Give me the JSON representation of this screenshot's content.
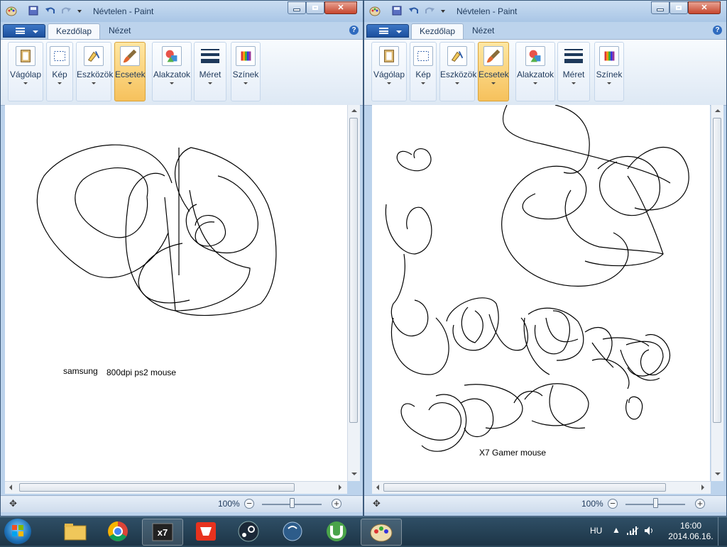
{
  "windows": [
    {
      "title": "Névtelen - Paint",
      "tabs": [
        "Kezdőlap",
        "Nézet"
      ],
      "groups": [
        {
          "label": "Vágólap",
          "icon": "clipboard-icon"
        },
        {
          "label": "Kép",
          "icon": "select-icon"
        },
        {
          "label": "Eszközök",
          "icon": "tools-icon"
        },
        {
          "label": "Ecsetek",
          "icon": "brush-icon",
          "active": true
        },
        {
          "label": "Alakzatok",
          "icon": "shapes-icon"
        },
        {
          "label": "Méret",
          "icon": "size-icon"
        },
        {
          "label": "Színek",
          "icon": "colors-icon"
        }
      ],
      "canvas_texts": [
        {
          "text": "samsung",
          "name": "caption-samsung"
        },
        {
          "text": "800dpi ps2 mouse",
          "name": "caption-800dpi"
        }
      ],
      "zoom": "100%"
    },
    {
      "title": "Névtelen - Paint",
      "tabs": [
        "Kezdőlap",
        "Nézet"
      ],
      "groups": [
        {
          "label": "Vágólap",
          "icon": "clipboard-icon"
        },
        {
          "label": "Kép",
          "icon": "select-icon"
        },
        {
          "label": "Eszközök",
          "icon": "tools-icon"
        },
        {
          "label": "Ecsetek",
          "icon": "brush-icon",
          "active": true
        },
        {
          "label": "Alakzatok",
          "icon": "shapes-icon"
        },
        {
          "label": "Méret",
          "icon": "size-icon"
        },
        {
          "label": "Színek",
          "icon": "colors-icon"
        }
      ],
      "canvas_texts": [
        {
          "text": "X7 Gamer mouse",
          "name": "caption-x7"
        }
      ],
      "zoom": "100%"
    }
  ],
  "taskbar": {
    "items": [
      "explorer-icon",
      "chrome-icon",
      "x7-app-icon",
      "gaming-app-icon",
      "steam-icon",
      "teamspeak-icon",
      "utorrent-icon",
      "paint-icon"
    ],
    "language": "HU",
    "time": "16:00",
    "date": "2014.06.16."
  },
  "help_label": "?",
  "zoom_minus": "−",
  "zoom_plus": "+"
}
